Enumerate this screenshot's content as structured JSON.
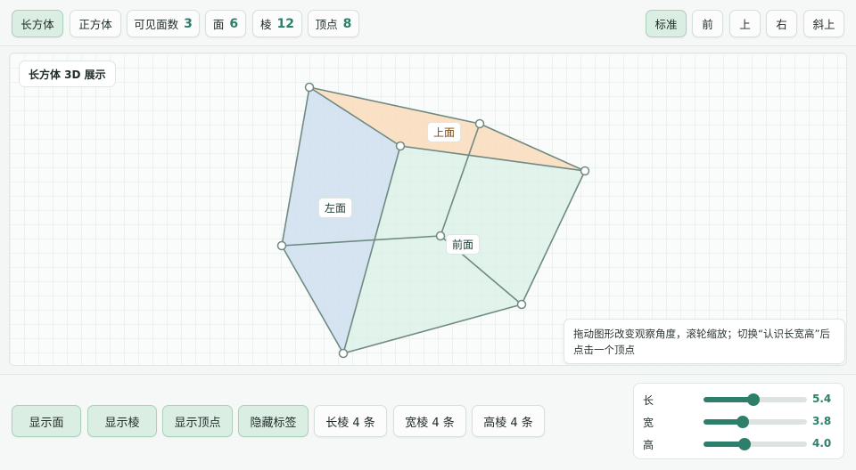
{
  "toolbar": {
    "shape_buttons": [
      {
        "label": "长方体",
        "active": true
      },
      {
        "label": "正方体",
        "active": false
      }
    ],
    "stats": [
      {
        "label": "可见面数",
        "value": "3"
      },
      {
        "label": "面",
        "value": "6"
      },
      {
        "label": "棱",
        "value": "12"
      },
      {
        "label": "顶点",
        "value": "8"
      }
    ],
    "view_buttons": [
      {
        "label": "标准",
        "active": true
      },
      {
        "label": "前",
        "active": false
      },
      {
        "label": "上",
        "active": false
      },
      {
        "label": "右",
        "active": false
      },
      {
        "label": "斜上",
        "active": false
      }
    ]
  },
  "canvas": {
    "title": "长方体 3D 展示",
    "face_labels": {
      "top": "上面",
      "left": "左面",
      "front": "前面"
    },
    "hint": "拖动图形改变观察角度，滚轮缩放；切换“认识长宽高”后点击一个顶点"
  },
  "bottom": {
    "toggle_buttons": [
      "显示面",
      "显示棱",
      "显示顶点",
      "隐藏标签"
    ],
    "edge_buttons": [
      "长棱 4 条",
      "宽棱 4 条",
      "高棱 4 条"
    ],
    "sliders": [
      {
        "label": "长",
        "value": "5.4",
        "fraction": 0.48
      },
      {
        "label": "宽",
        "value": "3.8",
        "fraction": 0.38
      },
      {
        "label": "高",
        "value": "4.0",
        "fraction": 0.4
      }
    ]
  },
  "colors": {
    "accent": "#2d7f6b",
    "top_face": "#f9dcbc",
    "left_face": "#c9dcee",
    "front_face": "#d6efe4",
    "edge": "#6f8a82"
  }
}
